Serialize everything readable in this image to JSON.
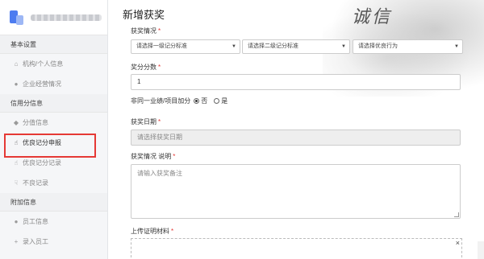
{
  "sidebar": {
    "groups": [
      {
        "title": "基本设置",
        "items": [
          {
            "label": "机构/个人信息",
            "icon": "bank-icon"
          },
          {
            "label": "企业经营情况",
            "icon": "user-icon"
          }
        ]
      },
      {
        "title": "信用分信息",
        "items": [
          {
            "label": "分值信息",
            "icon": "diamond-icon"
          },
          {
            "label": "优良记分申报",
            "icon": "hand-icon",
            "active": true
          },
          {
            "label": "优良记分记录",
            "icon": "hand-icon"
          },
          {
            "label": "不良记录",
            "icon": "hand-down-icon"
          }
        ]
      },
      {
        "title": "附加信息",
        "items": [
          {
            "label": "员工信息",
            "icon": "users-icon"
          },
          {
            "label": "录入员工",
            "icon": "add-user-icon"
          }
        ]
      }
    ]
  },
  "header": {
    "title": "新增获奖",
    "calligraphy": "诚信"
  },
  "form": {
    "award_situation_label": "获奖情况",
    "select_level1": "请选择一级记分标准",
    "select_level2": "请选择二级记分标准",
    "select_behavior": "请选择优良行为",
    "score_label": "奖分分数",
    "score_value": "1",
    "non_same_label": "非同一业绩/项目加分",
    "option_no": "否",
    "option_yes": "是",
    "award_date_label": "获奖日期",
    "award_date_placeholder": "请选择获奖日期",
    "desc_label": "获奖情况 说明",
    "desc_placeholder": "请输入获奖备注",
    "upload_label": "上传证明材料"
  },
  "colors": {
    "required": "#e53935",
    "highlight": "#e53935"
  }
}
